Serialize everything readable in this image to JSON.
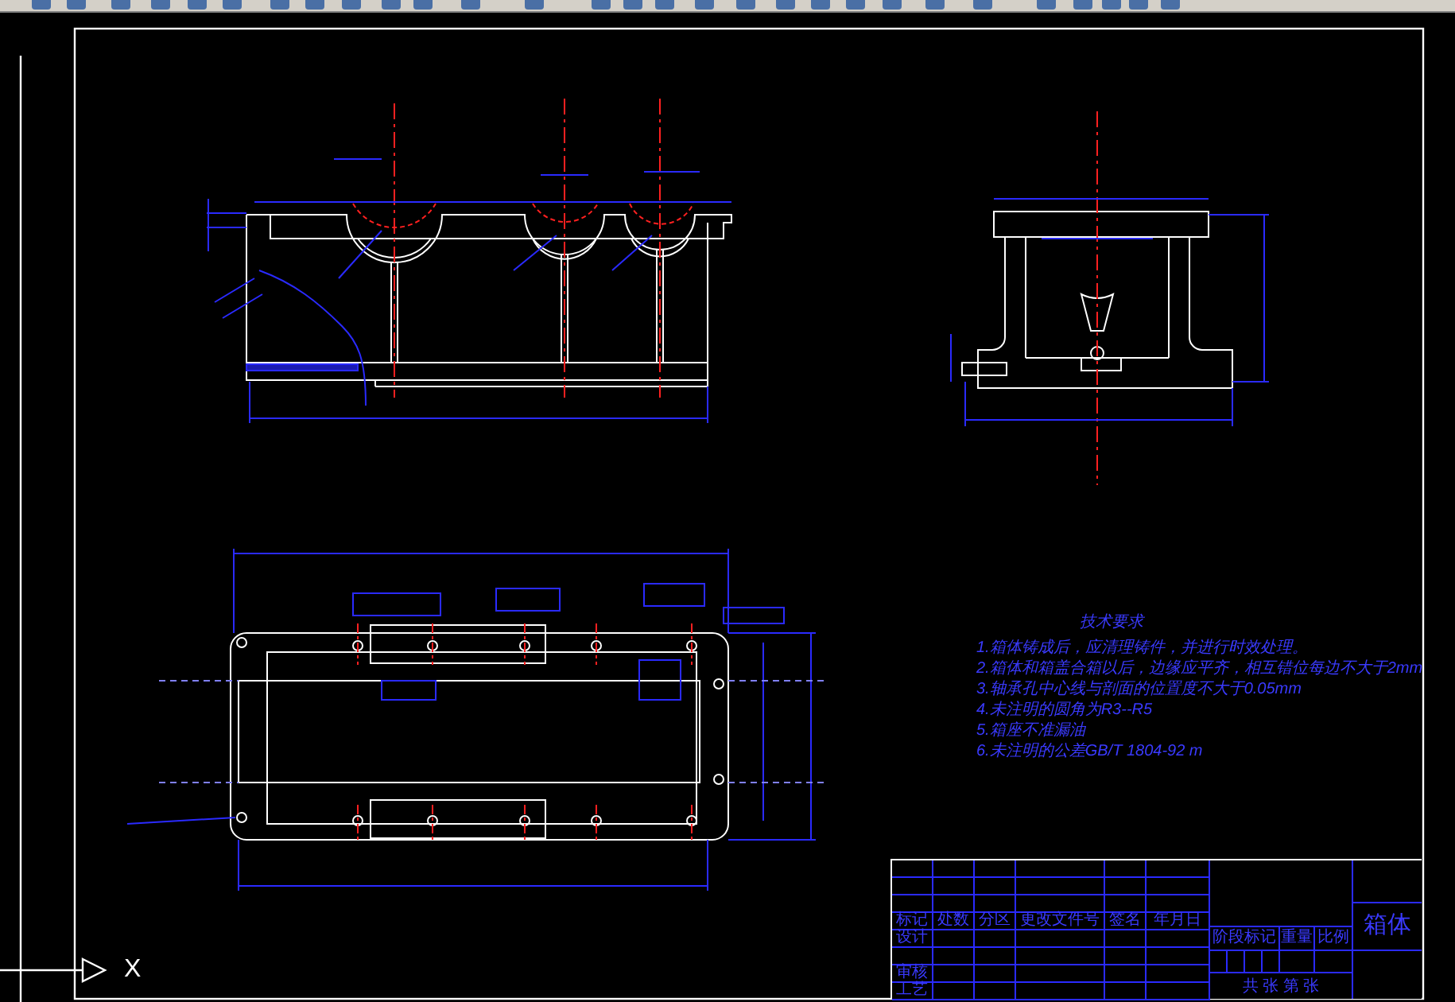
{
  "ucs": {
    "x_label": "X"
  },
  "technical_requirements": {
    "title": "技术要求",
    "items": [
      "1.箱体铸成后，应清理铸件，并进行时效处理。",
      "2.箱体和箱盖合箱以后，边缘应平齐，相互错位每边不大于2mm",
      "3.轴承孔中心线与剖面的位置度不大于0.05mm",
      "4.未注明的圆角为R3--R5",
      "5.箱座不准漏油",
      "6.未注明的公差GB/T 1804-92 m"
    ]
  },
  "title_block": {
    "revision_headers": [
      "标记",
      "处数",
      "分区",
      "更改文件号",
      "签名",
      "年月日"
    ],
    "signoff_labels": [
      "设计",
      "审核",
      "工艺"
    ],
    "stage_headers": [
      "阶段标记",
      "重量",
      "比例"
    ],
    "sheet_label": "共 张 第 张",
    "part_name": "箱体"
  }
}
